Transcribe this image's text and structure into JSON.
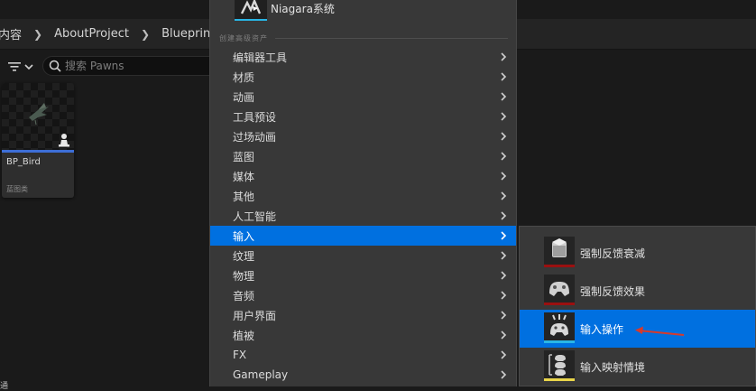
{
  "breadcrumb": {
    "items": [
      "内容",
      "AboutProject",
      "Blueprints"
    ]
  },
  "search": {
    "placeholder": "搜索 Pawns"
  },
  "asset": {
    "name": "BP_Bird",
    "type": "蓝图类",
    "type_color": "#3d6ed6"
  },
  "bottom_label": "通",
  "main_menu": {
    "top_item": "Niagara系统",
    "section_header": "创建高级资产",
    "items": [
      {
        "label": "编辑器工具"
      },
      {
        "label": "材质"
      },
      {
        "label": "动画"
      },
      {
        "label": "工具预设"
      },
      {
        "label": "过场动画"
      },
      {
        "label": "蓝图"
      },
      {
        "label": "媒体"
      },
      {
        "label": "其他"
      },
      {
        "label": "人工智能"
      },
      {
        "label": "输入",
        "active": true
      },
      {
        "label": "纹理"
      },
      {
        "label": "物理"
      },
      {
        "label": "音频"
      },
      {
        "label": "用户界面"
      },
      {
        "label": "植被"
      },
      {
        "label": "FX"
      },
      {
        "label": "Gameplay"
      }
    ]
  },
  "sub_menu": {
    "items": [
      {
        "label": "强制反馈衰减",
        "icon": "force-feedback-attenuation-icon",
        "bar_color": "#9a1010"
      },
      {
        "label": "强制反馈效果",
        "icon": "force-feedback-effect-icon",
        "bar_color": "#9a1010"
      },
      {
        "label": "输入操作",
        "icon": "input-action-icon",
        "bar_color": "#29b6e6",
        "active": true
      },
      {
        "label": "输入映射情境",
        "icon": "input-mapping-context-icon",
        "bar_color": "#e8d44a"
      }
    ]
  },
  "colors": {
    "highlight": "#0070e0",
    "menu_bg": "#383838",
    "annotation_arrow": "#d83a2a"
  }
}
